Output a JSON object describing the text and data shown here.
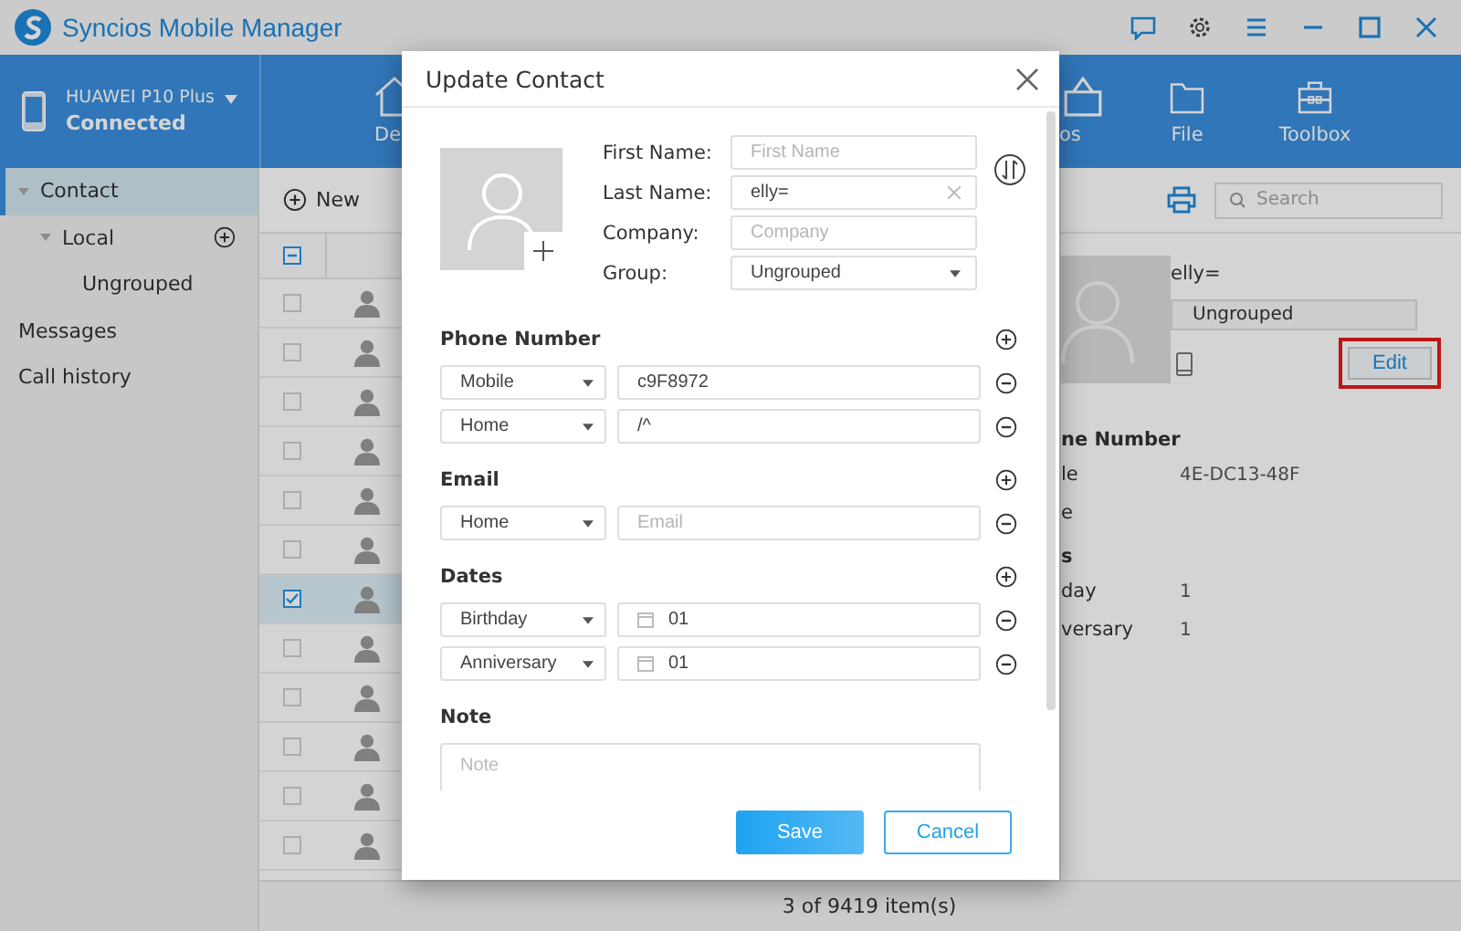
{
  "app": {
    "title": "Syncios Mobile Manager"
  },
  "device": {
    "name": "HUAWEI P10 Plus",
    "status": "Connected"
  },
  "nav": [
    {
      "kind": "home",
      "label": "De"
    },
    {
      "kind": "photos",
      "label": "os"
    },
    {
      "kind": "folder",
      "label": "File"
    },
    {
      "kind": "toolbox",
      "label": "Toolbox"
    }
  ],
  "sidebar": {
    "items": [
      {
        "label": "Contact",
        "selected": true,
        "expanded": true,
        "children": [
          {
            "label": "Local",
            "selected": false,
            "expanded": true,
            "children": [
              {
                "label": "Ungrouped",
                "selected": false
              }
            ]
          }
        ]
      },
      {
        "label": "Messages",
        "selected": false
      },
      {
        "label": "Call history",
        "selected": false
      }
    ]
  },
  "toolbar": {
    "new_label": "New",
    "search_placeholder": "Search"
  },
  "contacts": {
    "header_checkbox": {
      "indeterminate": true
    },
    "rows": [
      {
        "checked": false
      },
      {
        "checked": false
      },
      {
        "checked": false
      },
      {
        "checked": false
      },
      {
        "checked": false
      },
      {
        "checked": false
      },
      {
        "checked": true
      },
      {
        "checked": false
      },
      {
        "checked": false
      },
      {
        "checked": false
      },
      {
        "checked": false
      },
      {
        "checked": false
      }
    ]
  },
  "detail": {
    "name": "elly=",
    "group": "Ungrouped",
    "edit_label": "Edit",
    "sections": [
      {
        "heading": "ne Number",
        "rows": [
          {
            "label": "le",
            "value": "4E-DC13-48F"
          },
          {
            "label": "e"
          }
        ]
      },
      {
        "heading": "s",
        "rows": [
          {
            "label": "day",
            "value": "1"
          },
          {
            "label": "versary",
            "value": "1"
          }
        ]
      }
    ]
  },
  "status_bar": "3 of 9419 item(s)",
  "dialog": {
    "title": "Update Contact",
    "fields": [
      {
        "kind": "text",
        "label": "First Name:",
        "placeholder": "First Name"
      },
      {
        "kind": "text",
        "label": "Last Name:",
        "value": "elly="
      },
      {
        "kind": "text",
        "label": "Company:",
        "placeholder": "Company"
      },
      {
        "kind": "select",
        "label": "Group:",
        "value": "Ungrouped"
      }
    ],
    "sections": [
      {
        "kind": "phone",
        "heading": "Phone Number",
        "entries": [
          {
            "type": "Mobile",
            "value": "c9F8972"
          },
          {
            "type": "Home",
            "value": "/^"
          }
        ]
      },
      {
        "kind": "email",
        "heading": "Email",
        "entries": [
          {
            "type": "Home",
            "placeholder": "Email"
          }
        ]
      },
      {
        "kind": "date",
        "heading": "Dates",
        "entries": [
          {
            "type": "Birthday",
            "value": "01"
          },
          {
            "type": "Anniversary",
            "value": "01"
          }
        ]
      }
    ],
    "note": {
      "heading": "Note",
      "placeholder": "Note"
    },
    "buttons": [
      {
        "kind": "primary",
        "label": "Save"
      },
      {
        "kind": "secondary",
        "label": "Cancel"
      }
    ]
  }
}
